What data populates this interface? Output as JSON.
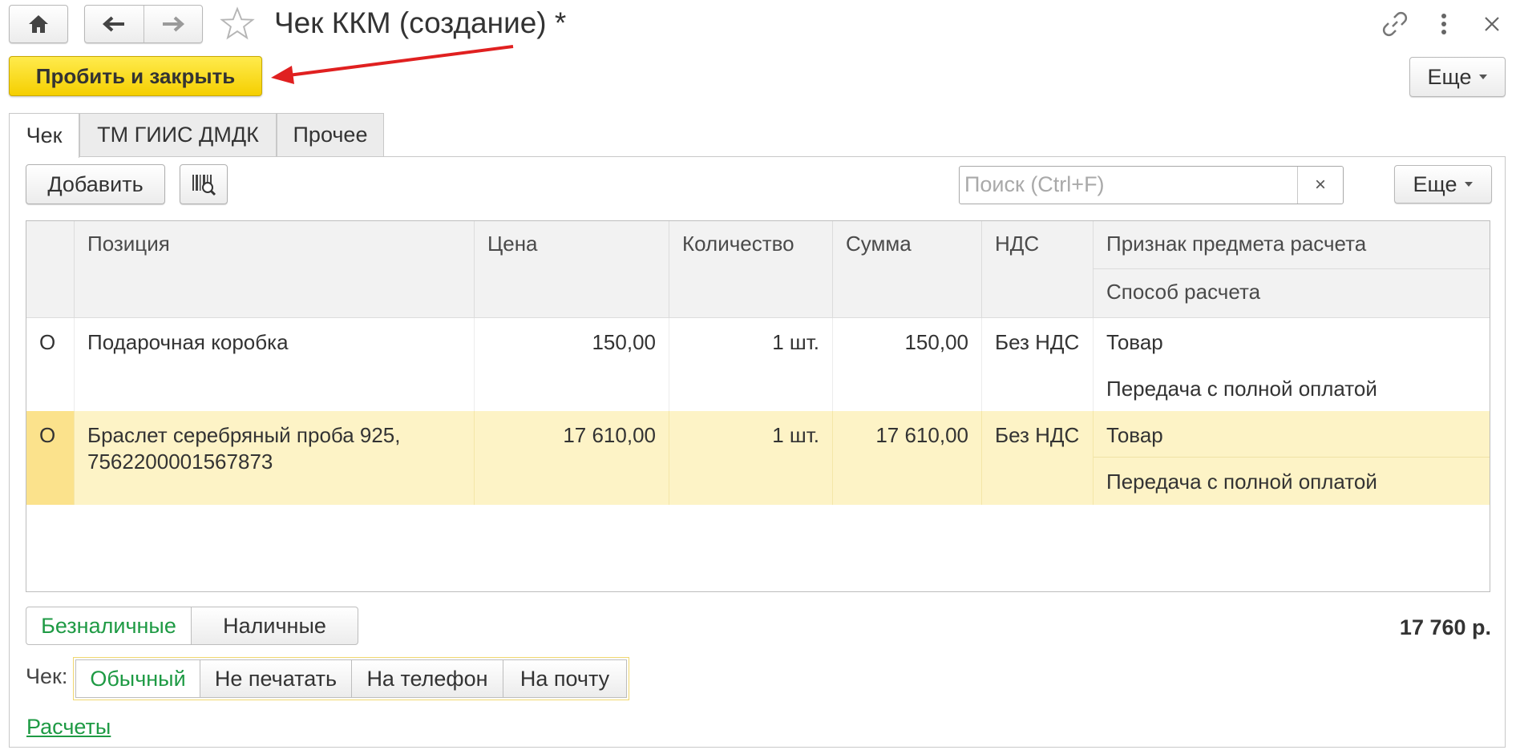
{
  "window": {
    "title": "Чек ККМ (создание) *",
    "icons": [
      "home-icon",
      "back-arrow-icon",
      "forward-arrow-icon",
      "star-icon",
      "link-icon",
      "kebab-menu-icon",
      "close-icon"
    ]
  },
  "toolbar": {
    "primary_label": "Пробить и закрыть",
    "more_label": "Еще"
  },
  "tabs": [
    {
      "label": "Чек",
      "active": true
    },
    {
      "label": "ТМ ГИИС ДМДК",
      "active": false
    },
    {
      "label": "Прочее",
      "active": false
    }
  ],
  "items_toolbar": {
    "add_label": "Добавить",
    "barcode_icon": "barcode-search-icon",
    "search_placeholder": "Поиск (Ctrl+F)",
    "search_clear": "×",
    "more_label": "Еще"
  },
  "table": {
    "columns": {
      "position": "Позиция",
      "price": "Цена",
      "quantity": "Количество",
      "sum": "Сумма",
      "vat": "НДС",
      "subject": "Признак предмета расчета",
      "method": "Способ расчета"
    },
    "rows": [
      {
        "mark": "O",
        "position": "Подарочная коробка",
        "price": "150,00",
        "quantity": "1 шт.",
        "sum": "150,00",
        "vat": "Без НДС",
        "subject": "Товар",
        "method": "Передача с полной оплатой",
        "selected": false
      },
      {
        "mark": "O",
        "position": "Браслет серебряный проба 925, 7562200001567873",
        "price": "17 610,00",
        "quantity": "1 шт.",
        "sum": "17 610,00",
        "vat": "Без НДС",
        "subject": "Товар",
        "method": "Передача с полной оплатой",
        "selected": true
      }
    ]
  },
  "payment": {
    "options": [
      {
        "label": "Безналичные",
        "active": true
      },
      {
        "label": "Наличные",
        "active": false
      }
    ],
    "total": "17 760 р."
  },
  "receipt": {
    "label": "Чек:",
    "options": [
      {
        "label": "Обычный",
        "active": true
      },
      {
        "label": "Не печатать",
        "active": false
      },
      {
        "label": "На телефон",
        "active": false
      },
      {
        "label": "На почту",
        "active": false
      }
    ]
  },
  "footer": {
    "link_label": "Расчеты"
  },
  "colors": {
    "primary_button": "#f5cf00",
    "selected_row": "#fdf3c6",
    "active_green": "#1e9a44",
    "annotation_arrow": "#e02020"
  }
}
